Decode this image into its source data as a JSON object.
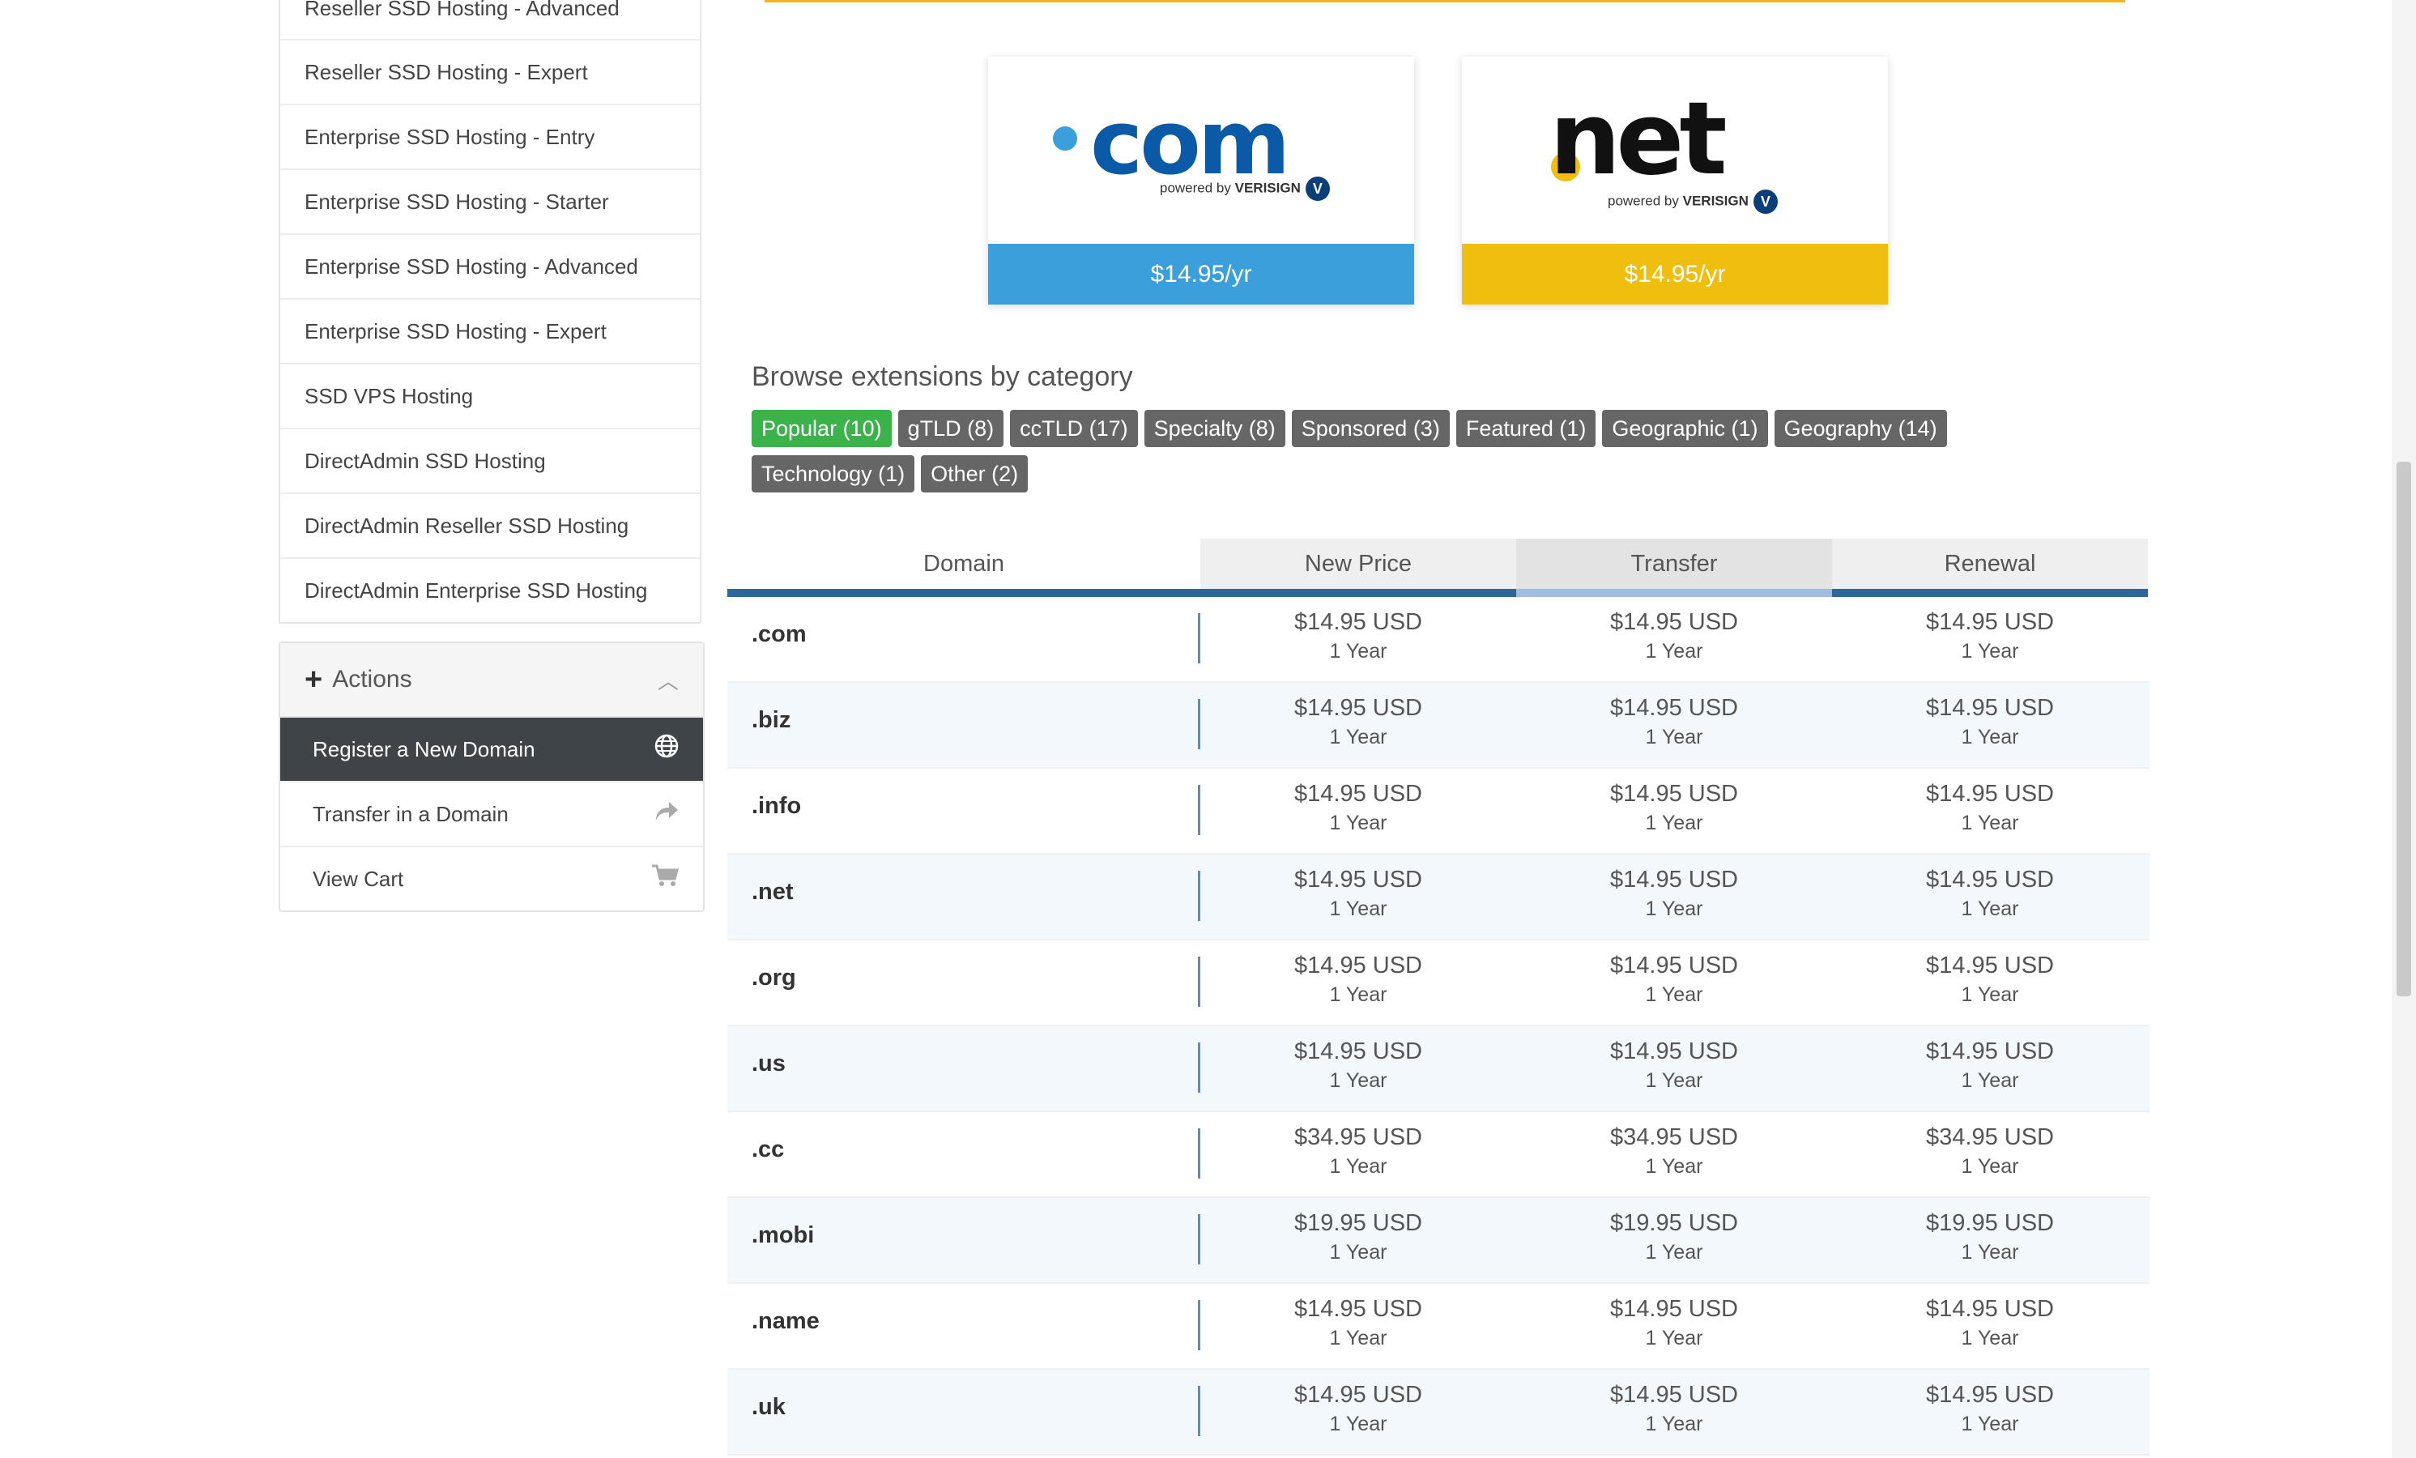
{
  "sidebar": {
    "categories": [
      "Reseller SSD Hosting - Advanced",
      "Reseller SSD Hosting - Expert",
      "Enterprise SSD Hosting - Entry",
      "Enterprise SSD Hosting - Starter",
      "Enterprise SSD Hosting - Advanced",
      "Enterprise SSD Hosting - Expert",
      "SSD VPS Hosting",
      "DirectAdmin SSD Hosting",
      "DirectAdmin Reseller SSD Hosting",
      "DirectAdmin Enterprise SSD Hosting"
    ],
    "actions": {
      "title": "Actions",
      "items": [
        "Register a New Domain",
        "Transfer in a Domain",
        "View Cart"
      ]
    }
  },
  "promos": [
    {
      "tld": "com",
      "powered": "powered by",
      "brand": "VERISIGN",
      "price": "$14.95/yr"
    },
    {
      "tld": "net",
      "powered": "powered by",
      "brand": "VERISIGN",
      "price": "$14.95/yr"
    }
  ],
  "browse": {
    "title": "Browse extensions by category",
    "categories": [
      "Popular (10)",
      "gTLD (8)",
      "ccTLD (17)",
      "Specialty (8)",
      "Sponsored (3)",
      "Featured (1)",
      "Geographic (1)",
      "Geography (14)",
      "Technology (1)",
      "Other (2)"
    ]
  },
  "table": {
    "headers": [
      "Domain",
      "New Price",
      "Transfer",
      "Renewal"
    ],
    "rows": [
      {
        "tld": ".com",
        "new": "$14.95 USD",
        "transfer": "$14.95 USD",
        "renewal": "$14.95 USD",
        "period": "1 Year"
      },
      {
        "tld": ".biz",
        "new": "$14.95 USD",
        "transfer": "$14.95 USD",
        "renewal": "$14.95 USD",
        "period": "1 Year"
      },
      {
        "tld": ".info",
        "new": "$14.95 USD",
        "transfer": "$14.95 USD",
        "renewal": "$14.95 USD",
        "period": "1 Year"
      },
      {
        "tld": ".net",
        "new": "$14.95 USD",
        "transfer": "$14.95 USD",
        "renewal": "$14.95 USD",
        "period": "1 Year"
      },
      {
        "tld": ".org",
        "new": "$14.95 USD",
        "transfer": "$14.95 USD",
        "renewal": "$14.95 USD",
        "period": "1 Year"
      },
      {
        "tld": ".us",
        "new": "$14.95 USD",
        "transfer": "$14.95 USD",
        "renewal": "$14.95 USD",
        "period": "1 Year"
      },
      {
        "tld": ".cc",
        "new": "$34.95 USD",
        "transfer": "$34.95 USD",
        "renewal": "$34.95 USD",
        "period": "1 Year"
      },
      {
        "tld": ".mobi",
        "new": "$19.95 USD",
        "transfer": "$19.95 USD",
        "renewal": "$19.95 USD",
        "period": "1 Year"
      },
      {
        "tld": ".name",
        "new": "$14.95 USD",
        "transfer": "$14.95 USD",
        "renewal": "$14.95 USD",
        "period": "1 Year"
      },
      {
        "tld": ".uk",
        "new": "$14.95 USD",
        "transfer": "$14.95 USD",
        "renewal": "$14.95 USD",
        "period": "1 Year"
      }
    ]
  },
  "colors": {
    "com_price": "#3a9fdb",
    "net_price": "#efbe0e",
    "active_category": "#3cb34a",
    "header_rule": "#2f6699"
  }
}
